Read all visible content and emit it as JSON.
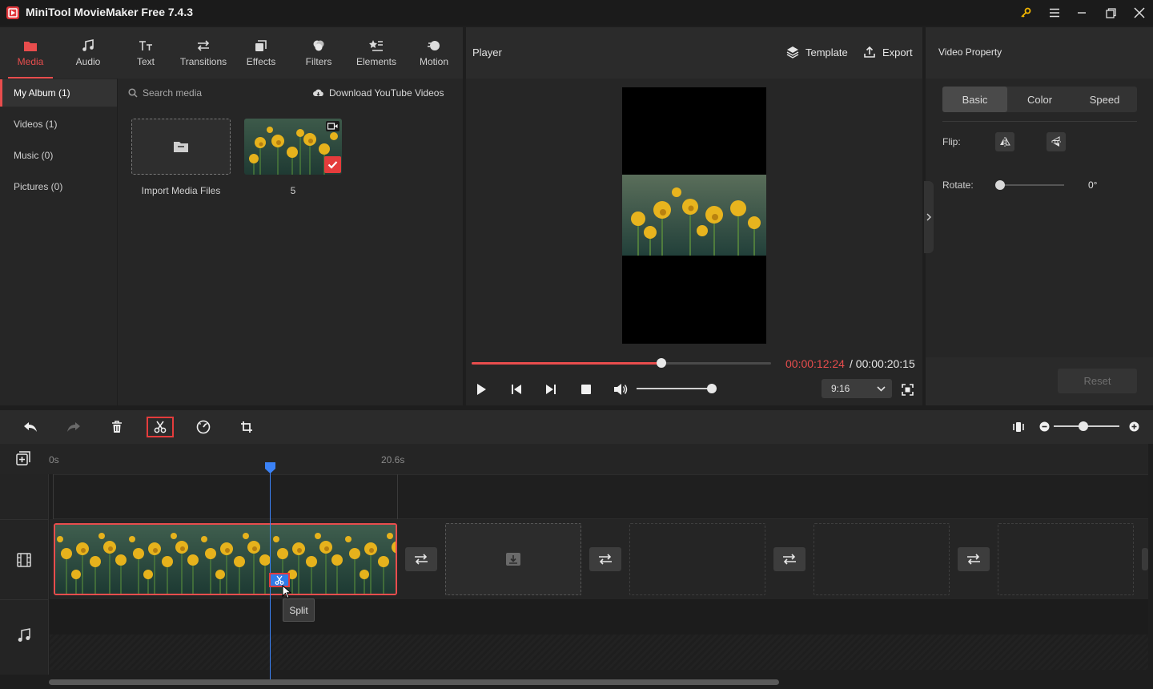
{
  "app": {
    "title": "MiniTool MovieMaker Free 7.4.3"
  },
  "toolbar": {
    "tabs": [
      {
        "label": "Media",
        "icon": "media-folder-icon"
      },
      {
        "label": "Audio",
        "icon": "music-note-icon"
      },
      {
        "label": "Text",
        "icon": "text-icon"
      },
      {
        "label": "Transitions",
        "icon": "transitions-icon"
      },
      {
        "label": "Effects",
        "icon": "effects-icon"
      },
      {
        "label": "Filters",
        "icon": "filters-icon"
      },
      {
        "label": "Elements",
        "icon": "elements-icon"
      },
      {
        "label": "Motion",
        "icon": "motion-icon"
      }
    ],
    "active_tab": "Media"
  },
  "sidebar": {
    "items": [
      {
        "label": "My Album (1)"
      },
      {
        "label": "Videos (1)"
      },
      {
        "label": "Music (0)"
      },
      {
        "label": "Pictures (0)"
      }
    ]
  },
  "media": {
    "search_placeholder": "Search media",
    "download_label": "Download YouTube Videos",
    "import_label": "Import Media Files",
    "items": [
      {
        "label": "5"
      }
    ]
  },
  "player": {
    "title": "Player",
    "template_label": "Template",
    "export_label": "Export",
    "current_time": "00:00:12:24",
    "total_time": "/ 00:00:20:15",
    "progress": 0.63,
    "volume": 0.94,
    "aspect_ratio": "9:16"
  },
  "property": {
    "title": "Video Property",
    "tabs": [
      "Basic",
      "Color",
      "Speed"
    ],
    "flip_label": "Flip:",
    "rotate_label": "Rotate:",
    "rotate_value": "0°",
    "reset_label": "Reset"
  },
  "timeline": {
    "ruler_start": "0s",
    "ruler_end": "20.6s",
    "tooltip": "Split",
    "zoom": 0.45
  },
  "colors": {
    "accent": "#e84d4d",
    "playhead": "#3b82f6",
    "highlight_border": "#e43c3c"
  }
}
